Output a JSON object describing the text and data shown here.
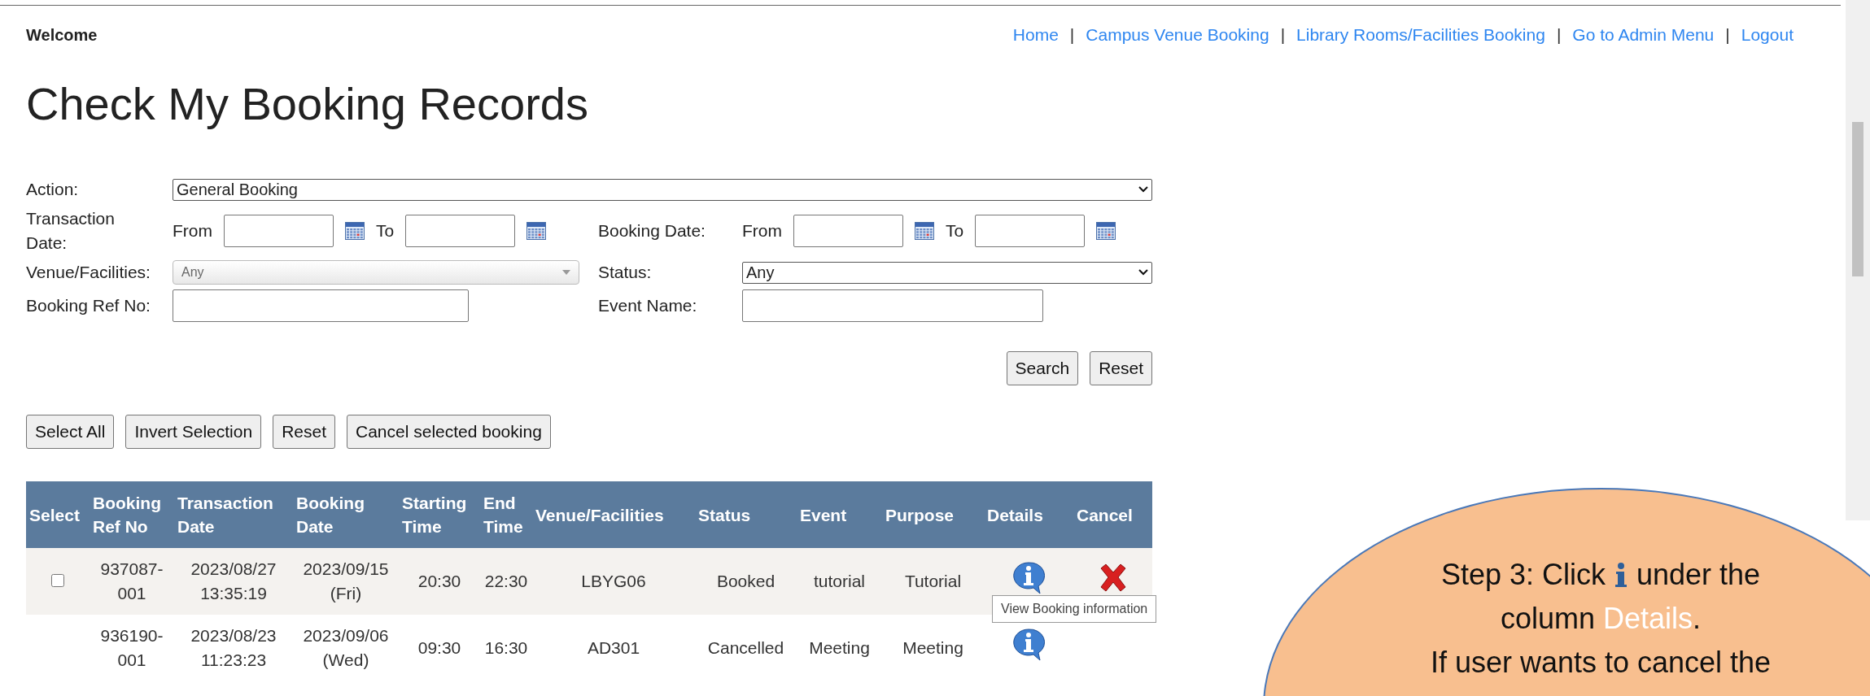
{
  "header": {
    "greeting": "Welcome",
    "nav": [
      {
        "kind": "link",
        "text": "Home"
      },
      {
        "kind": "separator",
        "text": "|"
      },
      {
        "kind": "link",
        "text": "Campus Venue Booking"
      },
      {
        "kind": "separator",
        "text": "|"
      },
      {
        "kind": "link",
        "text": "Library Rooms/Facilities Booking"
      },
      {
        "kind": "separator",
        "text": "|"
      },
      {
        "kind": "link",
        "text": "Go to Admin Menu"
      },
      {
        "kind": "separator",
        "text": "|"
      },
      {
        "kind": "link",
        "text": "Logout"
      }
    ]
  },
  "title": "Check My Booking Records",
  "filters": {
    "action_label": "Action:",
    "action_value": "General Booking",
    "transaction_date_label": "Transaction Date:",
    "transaction_from": "From",
    "transaction_to": "To",
    "booking_date_label": "Booking Date:",
    "booking_from": "From",
    "booking_to": "To",
    "venue_label": "Venue/Facilities:",
    "venue_value": "Any",
    "status_label": "Status:",
    "status_value": "Any",
    "ref_label": "Booking Ref No:",
    "event_label": "Event Name:"
  },
  "search_buttons": [
    "Search",
    "Reset"
  ],
  "bulk_buttons": [
    "Select All",
    "Invert Selection",
    "Reset",
    "Cancel selected booking"
  ],
  "table": {
    "columns": [
      "Select",
      "Booking Ref No",
      "Transaction Date",
      "Booking Date",
      "Starting Time",
      "End Time",
      "Venue/Facilities",
      "Status",
      "Event",
      "Purpose",
      "Details",
      "Cancel"
    ],
    "rows": [
      {
        "select": {
          "checked": false
        },
        "cells": [
          "",
          "937087-001",
          "2023/08/27 13:35:19",
          "2023/09/15 (Fri)",
          "20:30",
          "22:30",
          "LBYG06",
          "Booked",
          "tutorial",
          "Tutorial"
        ],
        "cancellable": true
      },
      {
        "cells": [
          "",
          "936190-001",
          "2023/08/23 11:23:23",
          "2023/09/06 (Wed)",
          "09:30",
          "16:30",
          "AD301",
          "Cancelled",
          "Meeting",
          "Meeting"
        ],
        "cancellable": false
      }
    ],
    "tooltip": "View Booking information"
  },
  "callout": {
    "line1_start": "Step 3: Click",
    "line1_end": "under the",
    "line2_start": "column",
    "highlight": "Details",
    "line2_end": ".",
    "line3": "If user wants to cancel the"
  }
}
